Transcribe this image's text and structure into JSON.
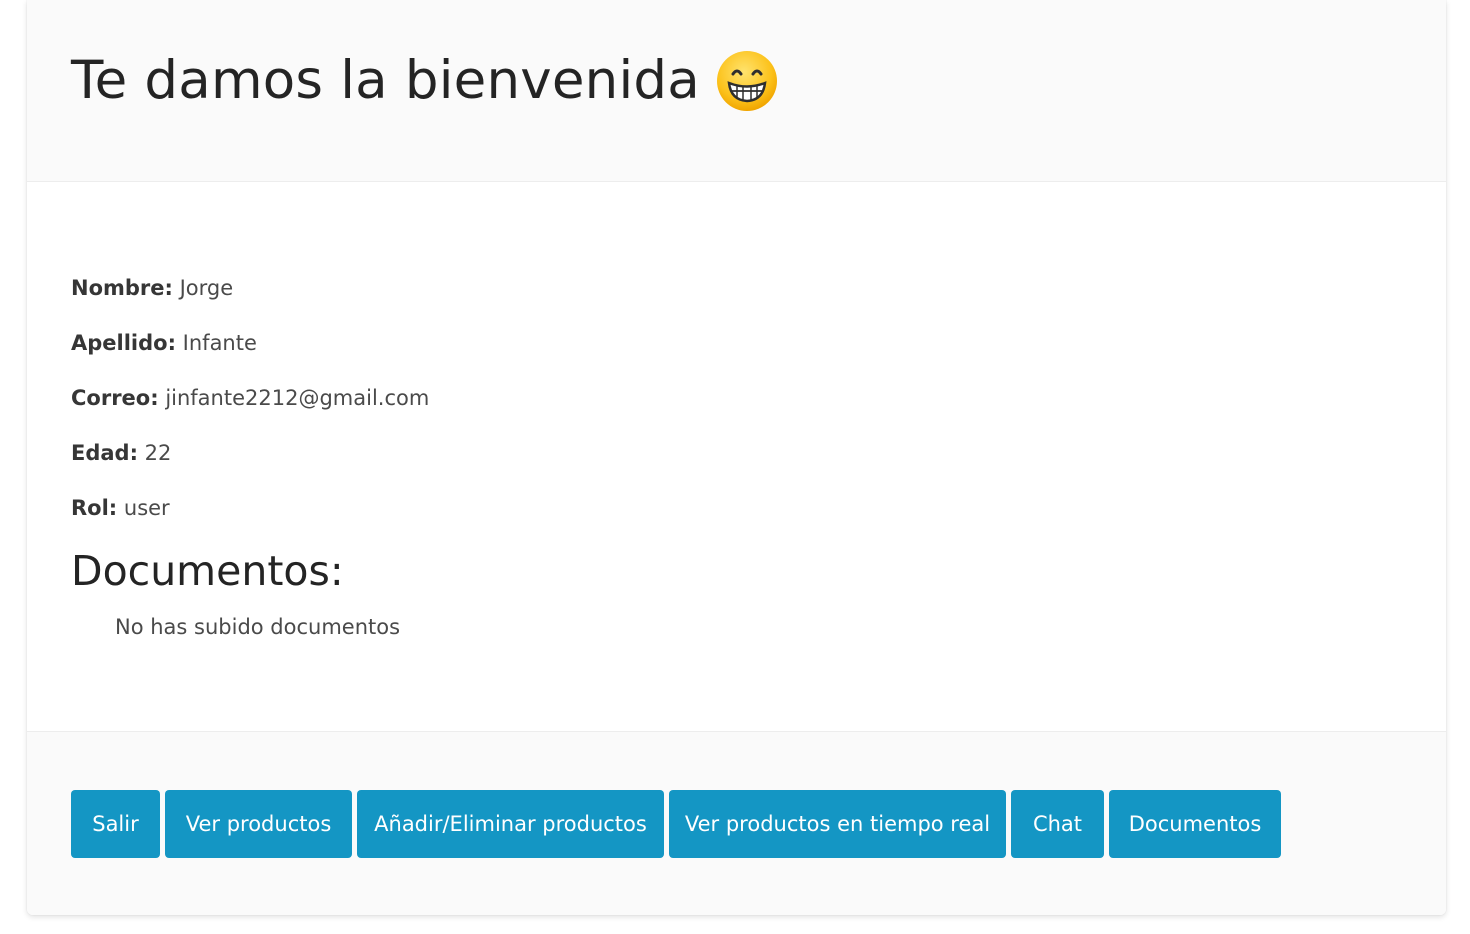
{
  "header": {
    "title": "Te damos la bienvenida",
    "emoji_icon": "grinning-face-icon"
  },
  "profile": {
    "nombre_label": "Nombre:",
    "nombre_value": "Jorge",
    "apellido_label": "Apellido:",
    "apellido_value": "Infante",
    "correo_label": "Correo:",
    "correo_value": "jinfante2212@gmail.com",
    "edad_label": "Edad:",
    "edad_value": "22",
    "rol_label": "Rol:",
    "rol_value": "user"
  },
  "documents": {
    "title": "Documentos:",
    "empty_message": "No has subido documentos"
  },
  "footer": {
    "buttons": [
      {
        "label": "Salir"
      },
      {
        "label": "Ver productos"
      },
      {
        "label": "Añadir/Eliminar productos"
      },
      {
        "label": "Ver productos en tiempo real"
      },
      {
        "label": "Chat"
      },
      {
        "label": "Documentos"
      }
    ]
  },
  "colors": {
    "button_bg": "#1496c4",
    "header_bg": "#fafafa",
    "title_text": "#242424"
  }
}
